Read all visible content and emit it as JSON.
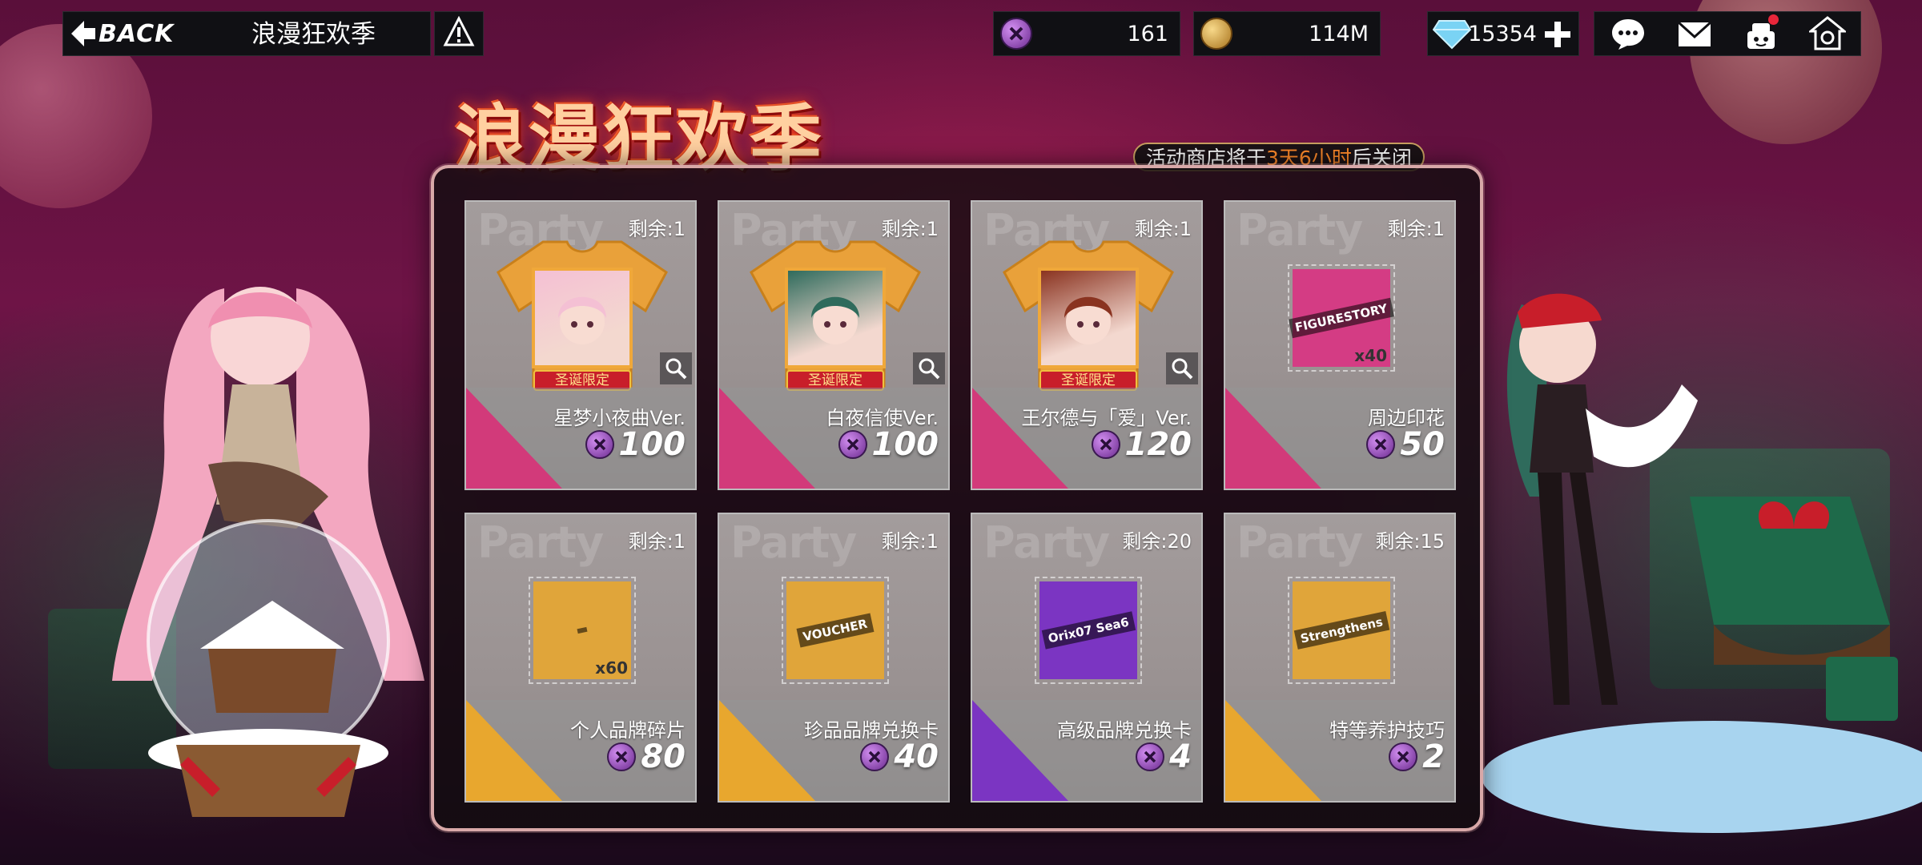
{
  "header": {
    "back_label": "BACK",
    "page_title": "浪漫狂欢季"
  },
  "resources": [
    {
      "name": "event-token",
      "value": "161",
      "color": "#9b4fc8"
    },
    {
      "name": "gold-coin",
      "value": "114M",
      "color": "#d7a640"
    },
    {
      "name": "diamond",
      "value": "15354",
      "color": "#7ad3f4"
    }
  ],
  "event": {
    "title": "浪漫狂欢季",
    "notice_prefix": "活动商店将于",
    "notice_time": "3天6小时",
    "notice_suffix": "后关闭"
  },
  "shop": {
    "items": [
      {
        "name": "星梦小夜曲Ver.",
        "stock": "剩余:1",
        "price": "100",
        "kind": "outfit",
        "badge": "圣诞限定",
        "stripe": "#d23a7a",
        "accent": "#f4c0d4"
      },
      {
        "name": "白夜信使Ver.",
        "stock": "剩余:1",
        "price": "100",
        "kind": "outfit",
        "badge": "圣诞限定",
        "stripe": "#d23a7a",
        "accent": "#2f6b5c"
      },
      {
        "name": "王尔德与「爱」Ver.",
        "stock": "剩余:1",
        "price": "120",
        "kind": "outfit",
        "badge": "圣诞限定",
        "stripe": "#d23a7a",
        "accent": "#8a3320"
      },
      {
        "name": "周边印花",
        "stock": "剩余:1",
        "price": "50",
        "kind": "square",
        "tile": "#d43c84",
        "label": "FIGURESTORY",
        "qty": "x40",
        "stripe": "#d23a7a"
      },
      {
        "name": "个人品牌碎片",
        "stock": "剩余:1",
        "price": "80",
        "kind": "square",
        "tile": "#e0a53a",
        "label": "",
        "qty": "x60",
        "stripe": "#e8a72e"
      },
      {
        "name": "珍品品牌兑换卡",
        "stock": "剩余:1",
        "price": "40",
        "kind": "square",
        "tile": "#e0a53a",
        "label": "VOUCHER",
        "qty": "",
        "stripe": "#e8a72e"
      },
      {
        "name": "高级品牌兑换卡",
        "stock": "剩余:20",
        "price": "4",
        "kind": "square",
        "tile": "#7b35c2",
        "label": "Orix07 Sea6",
        "qty": "",
        "stripe": "#7b35c2"
      },
      {
        "name": "特等养护技巧",
        "stock": "剩余:15",
        "price": "2",
        "kind": "square",
        "tile": "#e0a53a",
        "label": "Strengthens",
        "qty": "",
        "stripe": "#e8a72e"
      }
    ]
  },
  "watermark": "Party",
  "icons": [
    "back-arrow-icon",
    "info-icon",
    "event-token-icon",
    "gold-coin-icon",
    "diamond-icon",
    "add-icon",
    "chat-icon",
    "mail-icon",
    "cake-icon",
    "home-icon",
    "zoom-icon"
  ]
}
